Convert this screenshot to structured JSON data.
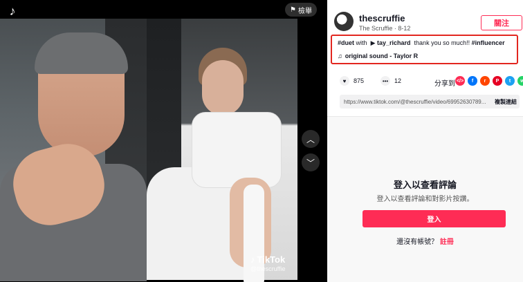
{
  "video": {
    "report_label": "檢舉",
    "watermark_brand": "TikTok",
    "watermark_user": "@thescruffie"
  },
  "author": {
    "username": "thescruffie",
    "subline": "The Scruffie · 8-12",
    "follow_label": "關注"
  },
  "caption": {
    "tag_duet": "#duet",
    "with_text": "with",
    "mention": "tay_richard",
    "text": "thank you so much!!",
    "tag_influencer": "#influencer",
    "sound": "original sound - Taylor R"
  },
  "stats": {
    "likes": "875",
    "comments": "12",
    "share_label": "分享到"
  },
  "link": {
    "url": "https://www.tiktok.com/@thescruffie/video/69952630789...",
    "copy_label": "複製連結"
  },
  "comments": {
    "login_title": "登入以查看評論",
    "login_subtitle": "登入以查看評論和對影片按讚。",
    "login_button": "登入",
    "no_account_text": "還沒有帳號？",
    "signup_link": "註冊"
  },
  "colors": {
    "brand": "#fe2c55",
    "highlight": "#e2261f"
  }
}
